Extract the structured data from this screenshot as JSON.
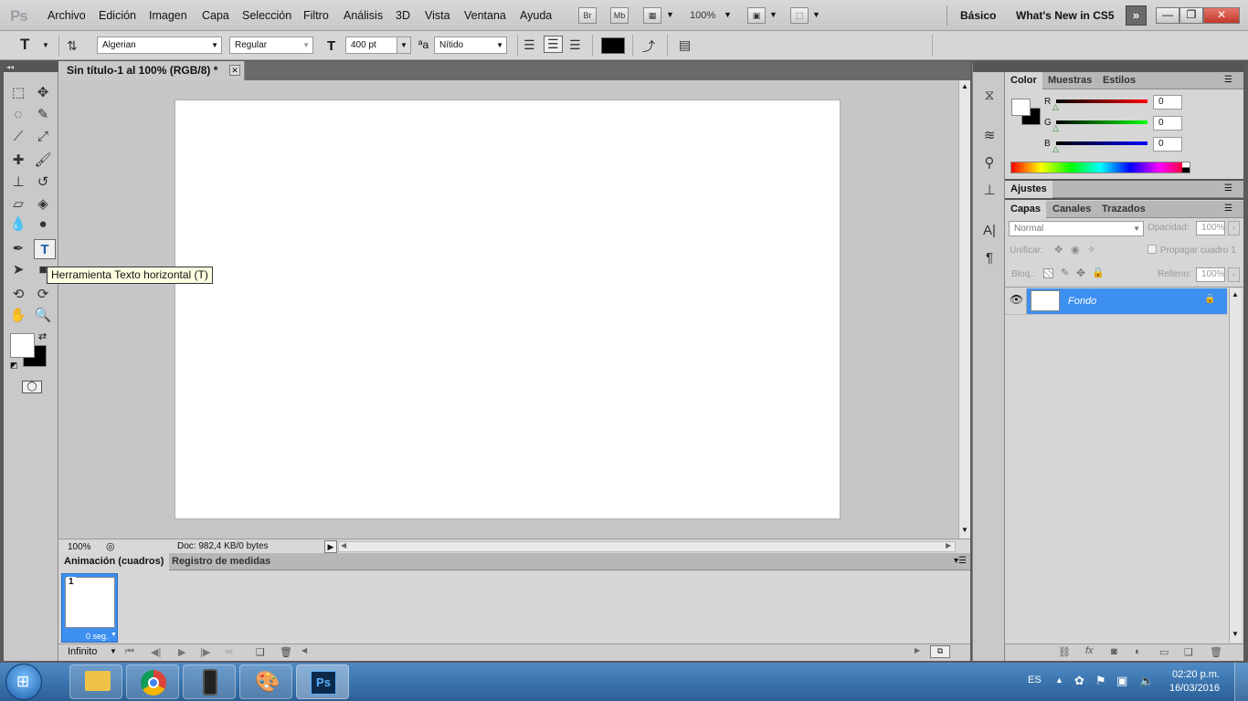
{
  "app": {
    "logo": "Ps"
  },
  "menu": {
    "items": [
      "Archivo",
      "Edición",
      "Imagen",
      "Capa",
      "Selección",
      "Filtro",
      "Análisis",
      "3D",
      "Vista",
      "Ventana",
      "Ayuda"
    ]
  },
  "appbar": {
    "bridge_label": "Br",
    "minibridge_label": "Mb",
    "zoom_value": "100%",
    "workspace_basic": "Básico",
    "workspace_whatsnew": "What's New in CS5"
  },
  "options": {
    "font_family": "Algerian",
    "font_style": "Regular",
    "font_size": "400 pt",
    "antialias": "Nítido",
    "text_color": "#000000"
  },
  "document": {
    "tab_title": "Sin título-1 al 100% (RGB/8) *",
    "zoom": "100%",
    "doc_info": "Doc: 982,4 KB/0 bytes"
  },
  "tooltip": {
    "text": "Herramienta Texto horizontal (T)"
  },
  "animation_panel": {
    "tabs": [
      "Animación (cuadros)",
      "Registro de medidas"
    ],
    "frame_number": "1",
    "frame_delay": "0 seg.",
    "loop": "Infinito"
  },
  "color_panel": {
    "tabs": [
      "Color",
      "Muestras",
      "Estilos"
    ],
    "r_label": "R",
    "g_label": "G",
    "b_label": "B",
    "r": "0",
    "g": "0",
    "b": "0"
  },
  "adjustments_panel": {
    "tab": "Ajustes"
  },
  "layers_panel": {
    "tabs": [
      "Capas",
      "Canales",
      "Trazados"
    ],
    "blend_mode": "Normal",
    "opacity_label": "Opacidad:",
    "opacity": "100%",
    "unify_label": "Unificar:",
    "propagate_label": "Propagar cuadro 1",
    "lock_label": "Bloq.:",
    "fill_label": "Relleno:",
    "fill": "100%",
    "layer_name": "Fondo"
  },
  "taskbar": {
    "language": "ES",
    "time": "02:20 p.m.",
    "date": "16/03/2016",
    "ps_label": "Ps"
  }
}
